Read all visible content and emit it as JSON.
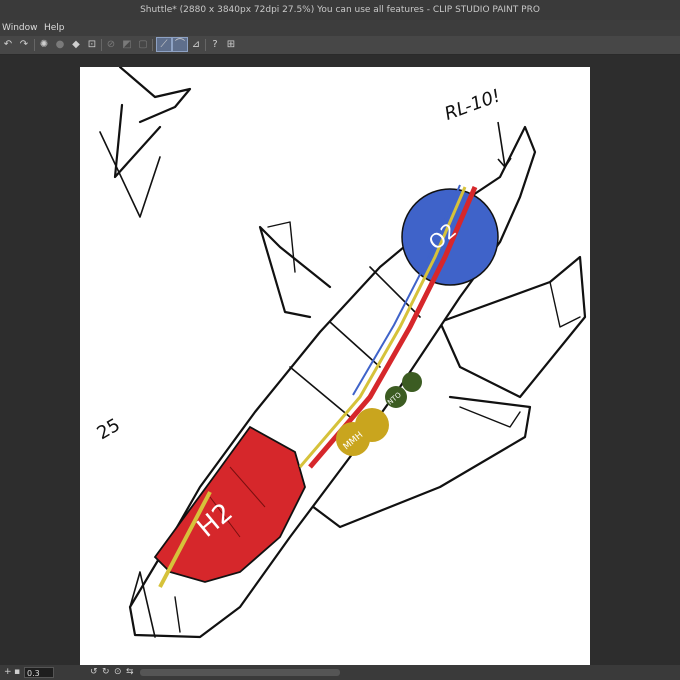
{
  "window": {
    "title": "Shuttle* (2880 x 3840px 72dpi 27.5%)  You can use all features - CLIP STUDIO PAINT PRO"
  },
  "menu": {
    "items": [
      {
        "label": "Window"
      },
      {
        "label": "Help"
      }
    ]
  },
  "toolbar": {
    "icons": [
      "undo-icon",
      "redo-icon",
      "clear-icon",
      "fill-icon",
      "transform-icon",
      "crop-icon",
      "selection-icon",
      "snap-ruler-icon",
      "snap-special-ruler-icon",
      "ruler-icon",
      "help-icon",
      "grid-icon"
    ]
  },
  "status": {
    "zoom_value": "0.3"
  },
  "drawing": {
    "labels": {
      "engine_note": "RL-10!",
      "oxygen_tank": "O2",
      "hydrogen_tank": "H2",
      "mmh_tank": "MMH",
      "nto_tank": "NTO",
      "side_note": "25"
    },
    "colors": {
      "h2_tank": "#d6272b",
      "o2_tank": "#3f63c9",
      "mmh_tank": "#c9a51e",
      "nto_tank": "#3c5c22",
      "canvas_bg": "#ffffff",
      "workspace_bg": "#2d2d2d"
    }
  }
}
